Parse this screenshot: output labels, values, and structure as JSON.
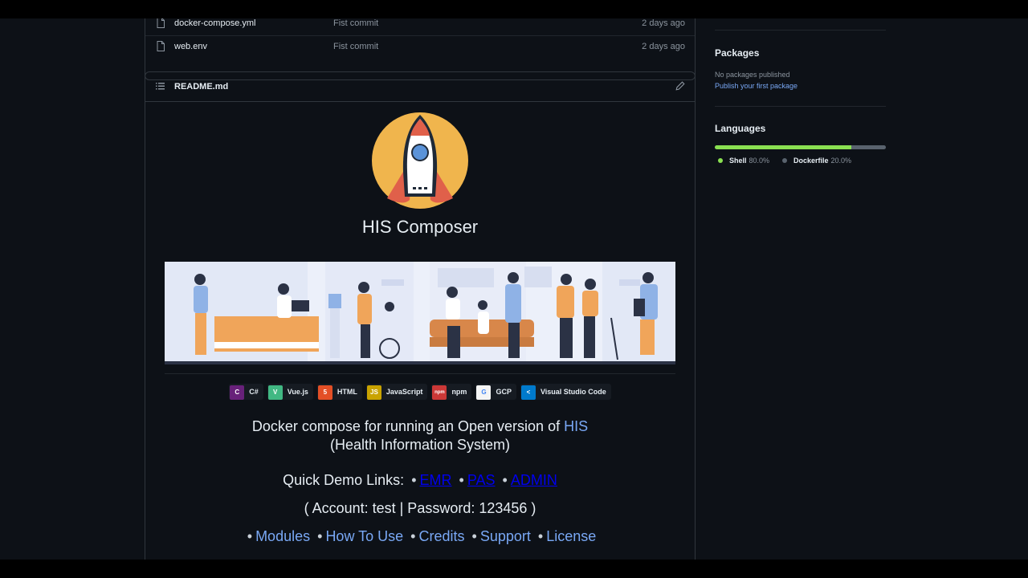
{
  "files": [
    {
      "name": "docker-compose.yml",
      "commit": "Fist commit",
      "date": "2 days ago"
    },
    {
      "name": "web.env",
      "commit": "Fist commit",
      "date": "2 days ago"
    }
  ],
  "readme": {
    "title": "README.md",
    "project_title": "HIS Composer",
    "badges": [
      {
        "label": "C#",
        "icon": "csharp-icon",
        "color": "#68217a",
        "glyph": "C"
      },
      {
        "label": "Vue.js",
        "icon": "vue-icon",
        "color": "#41b883",
        "glyph": "V"
      },
      {
        "label": "HTML",
        "icon": "html5-icon",
        "color": "#e34f26",
        "glyph": "5"
      },
      {
        "label": "JavaScript",
        "icon": "javascript-icon",
        "color": "#c9a300",
        "glyph": "JS"
      },
      {
        "label": "npm",
        "icon": "npm-icon",
        "color": "#cb3837",
        "glyph": "npm"
      },
      {
        "label": "GCP",
        "icon": "gcp-icon",
        "color": "#f5f5f5",
        "glyph": "G"
      },
      {
        "label": "Visual Studio Code",
        "icon": "vscode-icon",
        "color": "#007acc",
        "glyph": "&lt;"
      }
    ],
    "desc_line1": "Docker compose for running an Open version of",
    "desc_link": "HIS",
    "desc_line2": "(Health Information System)",
    "quick_label": "Quick Demo Links:",
    "quick_links": [
      "EMR",
      "PAS",
      "ADMIN"
    ],
    "account": "( Account: test | Password: 123456 )",
    "nav_links": [
      "Modules",
      "How To Use",
      "Credits",
      "Support",
      "License"
    ]
  },
  "sidebar": {
    "packages_heading": "Packages",
    "packages_none": "No packages published",
    "packages_link": "Publish your first package",
    "languages_heading": "Languages",
    "languages": [
      {
        "name": "Shell",
        "percent": "80.0%",
        "value": 80.0,
        "color": "#89e051"
      },
      {
        "name": "Dockerfile",
        "percent": "20.0%",
        "value": 20.0,
        "color": "#384d54"
      }
    ]
  },
  "colors": {
    "accent_link": "#79a8f5",
    "background": "#0d1117",
    "border": "#30363d"
  }
}
